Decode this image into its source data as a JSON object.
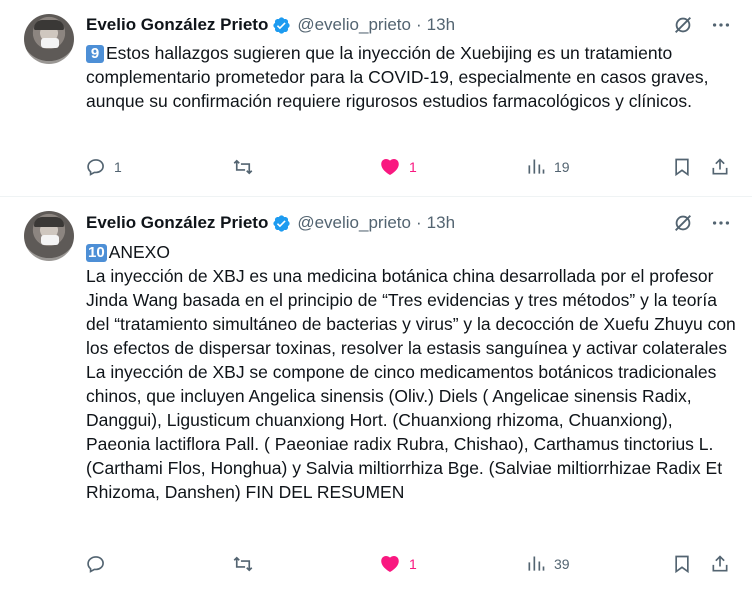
{
  "tweets": [
    {
      "author_name": "Evelio González Prieto",
      "handle": "@evelio_prieto",
      "separator": "·",
      "time": "13h",
      "number_badge": "9",
      "text": "Estos hallazgos sugieren que la inyección de Xuebijing es un tratamiento complementario prometedor para la COVID-19, especialmente en casos graves, aunque su confirmación requiere rigurosos estudios farmacológicos y clínicos.",
      "replies": "1",
      "reposts": "",
      "likes": "1",
      "views": "19"
    },
    {
      "author_name": "Evelio González Prieto",
      "handle": "@evelio_prieto",
      "separator": "·",
      "time": "13h",
      "number_badge": "10",
      "text": "ANEXO\nLa inyección de XBJ es una medicina botánica china desarrollada por el profesor Jinda Wang basada en el principio de “Tres evidencias y tres métodos” y la teoría del “tratamiento simultáneo de bacterias y virus” y la decocción de Xuefu Zhuyu con los efectos de dispersar toxinas, resolver la estasis sanguínea y activar colaterales\nLa inyección de XBJ se compone de cinco medicamentos botánicos tradicionales chinos, que incluyen Angelica sinensis (Oliv.) Diels ( Angelicae sinensis Radix, Danggui), Ligusticum chuanxiong Hort. (Chuanxiong rhizoma, Chuanxiong), Paeonia lactiflora Pall. ( Paeoniae radix Rubra, Chishao), Carthamus tinctorius L. (Carthami Flos, Honghua) y Salvia miltiorrhiza Bge. (Salviae miltiorrhizae Radix Et Rhizoma, Danshen) FIN DEL RESUMEN",
      "replies": "",
      "reposts": "",
      "likes": "1",
      "views": "39"
    }
  ],
  "icons": {
    "verified": "verified-badge-icon",
    "grok": "grok-icon",
    "more": "more-icon",
    "reply": "reply-icon",
    "repost": "repost-icon",
    "like": "heart-icon",
    "views": "views-icon",
    "bookmark": "bookmark-icon",
    "share": "share-icon"
  },
  "colors": {
    "like_active": "#f91880",
    "verified": "#1d9bf0",
    "secondary_text": "#536471",
    "keycap": "#4d8fd6"
  }
}
